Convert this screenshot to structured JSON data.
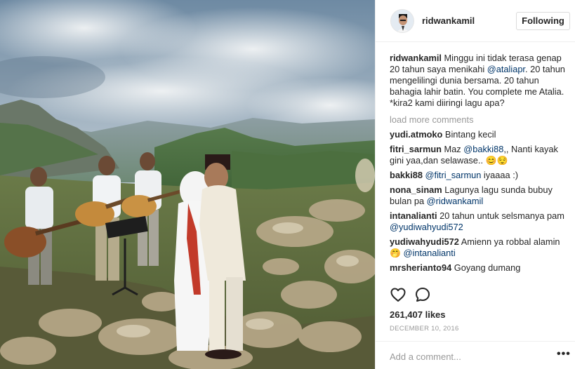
{
  "post": {
    "username": "ridwankamil",
    "follow_label": "Following",
    "caption": {
      "username": "ridwankamil",
      "text_1": " Minggu ini tidak terasa genap 20 tahun saya menikahi ",
      "mention": "@ataliapr",
      "text_2": ". 20 tahun mengelilingi dunia bersama. 20 tahun bahagia lahir batin. You complete me Atalia. *kira2 kami diiringi lagu apa?"
    },
    "load_more": "load more comments",
    "comments": [
      {
        "user": "yudi.atmoko",
        "text": " Bintang kecil"
      },
      {
        "user": "fitri_sarmun",
        "pre": " Maz ",
        "mention": "@bakki88",
        "post": ",, Nanti kayak gini yaa,dan selawase.. 😊😌"
      },
      {
        "user": "bakki88",
        "pre": " ",
        "mention": "@fitri_sarmun",
        "post": " iyaaaa :)"
      },
      {
        "user": "nona_sinam",
        "pre": " Lagunya lagu sunda bubuy bulan pa ",
        "mention": "@ridwankamil",
        "post": ""
      },
      {
        "user": "intanalianti",
        "pre": " 20 tahun untuk selsmanya pam ",
        "mention": "@yudiwahyudi572",
        "post": ""
      },
      {
        "user": "yudiwahyudi572",
        "pre": " Amienn ya robbal alamin🤭 ",
        "mention": "@intanalianti",
        "post": ""
      },
      {
        "user": "mrsherianto94",
        "text": " Goyang dumang"
      }
    ],
    "icons": {
      "like": "heart-icon",
      "comment": "comment-icon",
      "more": "more-options-icon"
    },
    "likes": "261,407 likes",
    "date": "December 10, 2016",
    "add_comment_placeholder": "Add a comment...",
    "more_label": "•••"
  }
}
